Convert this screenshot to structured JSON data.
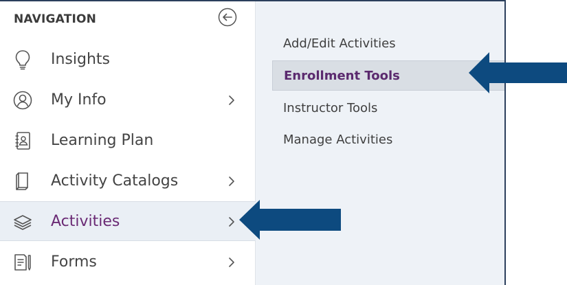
{
  "navigation": {
    "header": "NAVIGATION",
    "items": [
      {
        "label": "Insights",
        "icon": "lightbulb-icon",
        "has_submenu": false
      },
      {
        "label": "My Info",
        "icon": "user-circle-icon",
        "has_submenu": true
      },
      {
        "label": "Learning Plan",
        "icon": "address-book-icon",
        "has_submenu": false
      },
      {
        "label": "Activity Catalogs",
        "icon": "book-icon",
        "has_submenu": true
      },
      {
        "label": "Activities",
        "icon": "layers-icon",
        "has_submenu": true,
        "active": true
      },
      {
        "label": "Forms",
        "icon": "form-pen-icon",
        "has_submenu": true
      }
    ]
  },
  "submenu": {
    "items": [
      {
        "label": "Add/Edit Activities"
      },
      {
        "label": "Enrollment Tools",
        "active": true
      },
      {
        "label": "Instructor Tools"
      },
      {
        "label": "Manage Activities"
      }
    ]
  },
  "colors": {
    "active_text": "#6a2a74",
    "arrow": "#0d4a7f",
    "frame": "#2b3f5c"
  }
}
